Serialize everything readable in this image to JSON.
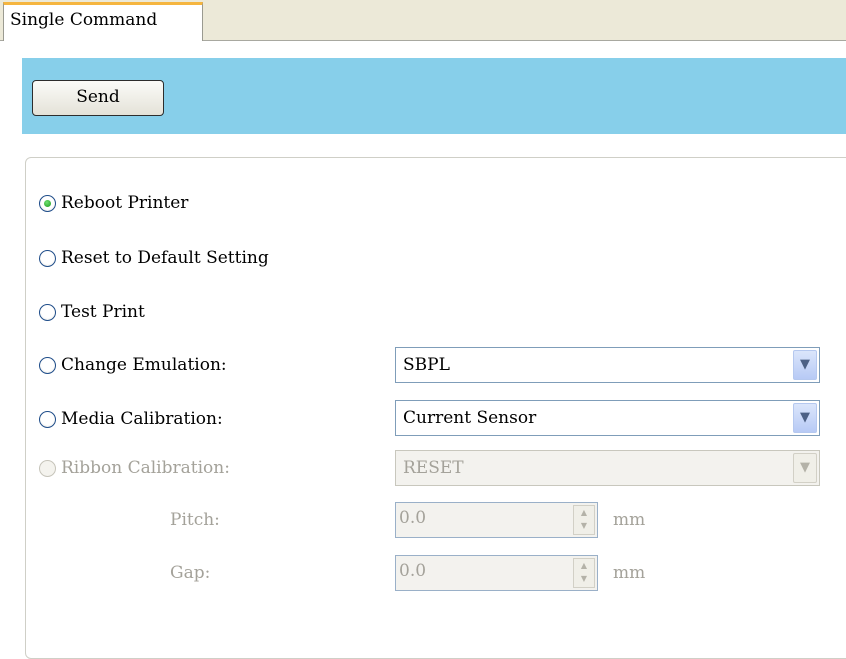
{
  "tabs": [
    {
      "label": "Single Command",
      "active": true
    }
  ],
  "toolbar": {
    "send_label": "Send"
  },
  "options": {
    "reboot": {
      "label": "Reboot Printer",
      "checked": true,
      "enabled": true
    },
    "reset": {
      "label": "Reset to Default Setting",
      "checked": false,
      "enabled": true
    },
    "test_print": {
      "label": "Test Print",
      "checked": false,
      "enabled": true
    },
    "emulation": {
      "label": "Change Emulation:",
      "checked": false,
      "enabled": true,
      "value": "SBPL"
    },
    "media": {
      "label": "Media Calibration:",
      "checked": false,
      "enabled": true,
      "value": "Current Sensor"
    },
    "ribbon": {
      "label": "Ribbon Calibration:",
      "checked": false,
      "enabled": false,
      "value": "RESET"
    }
  },
  "pitch": {
    "label": "Pitch:",
    "value": "0.0",
    "unit": "mm",
    "enabled": false
  },
  "gap": {
    "label": "Gap:",
    "value": "0.0",
    "unit": "mm",
    "enabled": false
  },
  "colors": {
    "toolbar_bg": "#87cfea",
    "tab_accent": "#f5b53f",
    "radio_dot": "#1d9a1d"
  },
  "icons": {
    "dropdown": "chevron-down-icon",
    "spinner": "spinner-arrows-icon"
  }
}
